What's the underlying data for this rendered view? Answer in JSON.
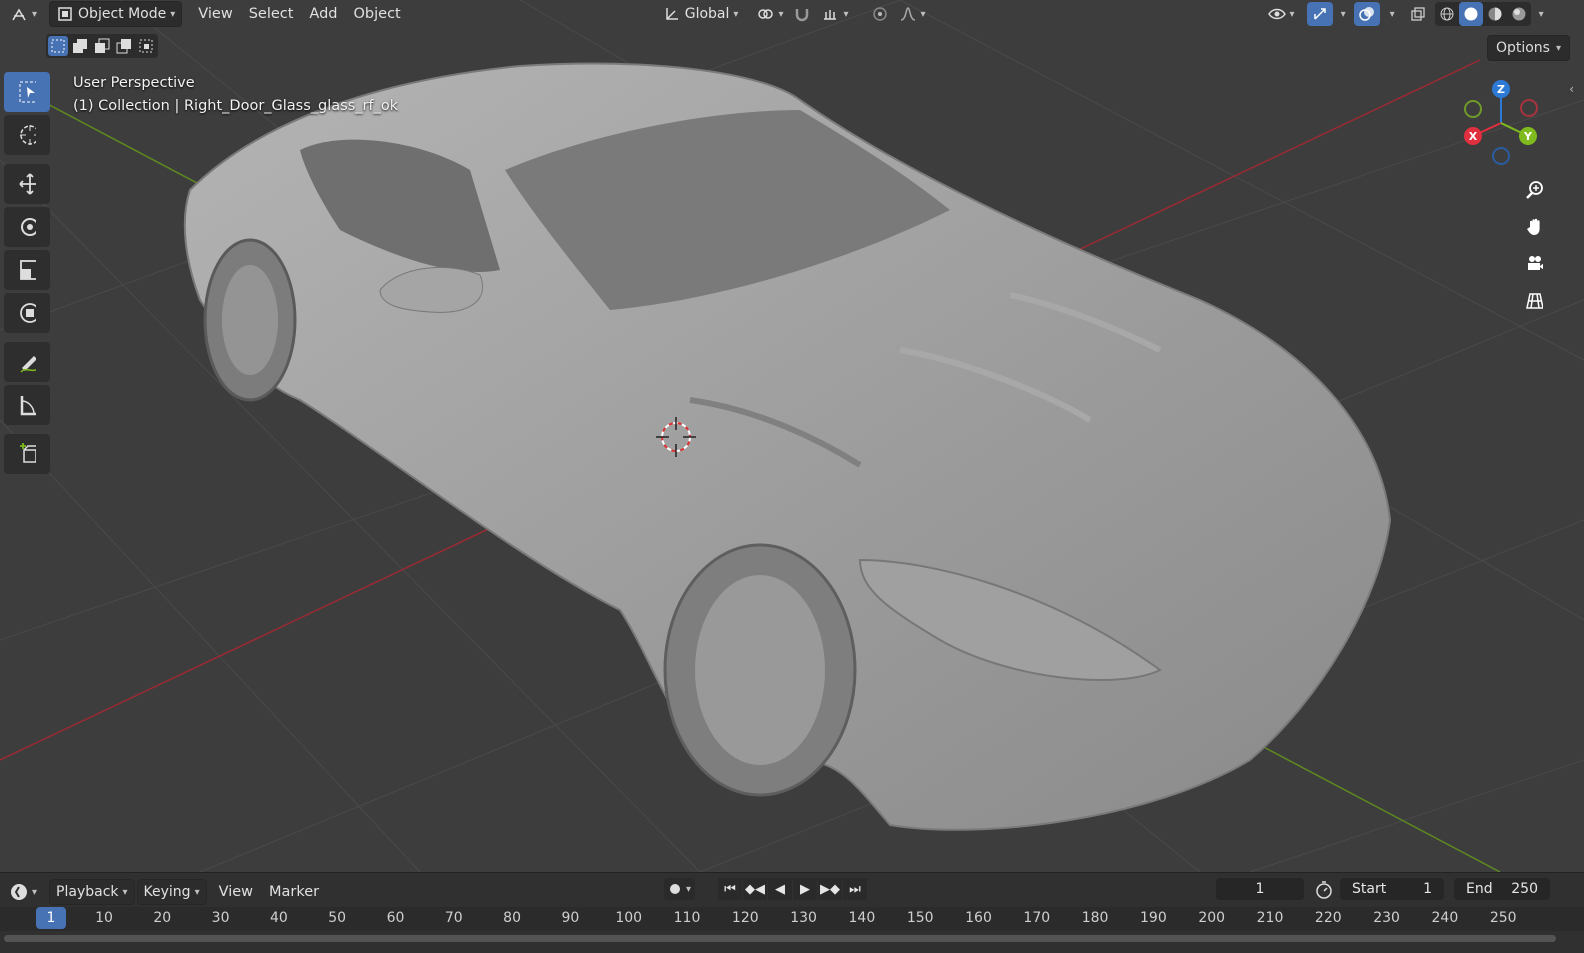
{
  "header": {
    "editor_type_icon": "editor-type-icon",
    "mode": "Object Mode",
    "menus": [
      "View",
      "Select",
      "Add",
      "Object"
    ],
    "orientation": "Global",
    "options_label": "Options"
  },
  "viewport": {
    "perspective": "User Perspective",
    "collection": "(1) Collection | Right_Door_Glass_glass_rf_ok"
  },
  "gizmo": {
    "x": "X",
    "y": "Y",
    "z": "Z"
  },
  "toolbar": {
    "tools": [
      "select-box",
      "cursor",
      "move",
      "rotate",
      "scale",
      "transform",
      "annotate",
      "measure",
      "add-cube"
    ],
    "active": "select-box"
  },
  "timeline": {
    "menus": [
      "Playback",
      "Keying",
      "View",
      "Marker"
    ],
    "current_frame": "1",
    "start_label": "Start",
    "start_value": "1",
    "end_label": "End",
    "end_value": "250",
    "ruler_current": "1",
    "ticks": [
      "10",
      "20",
      "30",
      "40",
      "50",
      "60",
      "70",
      "80",
      "90",
      "100",
      "110",
      "120",
      "130",
      "140",
      "150",
      "160",
      "170",
      "180",
      "190",
      "200",
      "210",
      "220",
      "230",
      "240",
      "250"
    ]
  },
  "colors": {
    "accent": "#4772b3",
    "axis_x": "#e0303f",
    "axis_y": "#7fbb1e",
    "axis_z": "#2d7ad6"
  }
}
